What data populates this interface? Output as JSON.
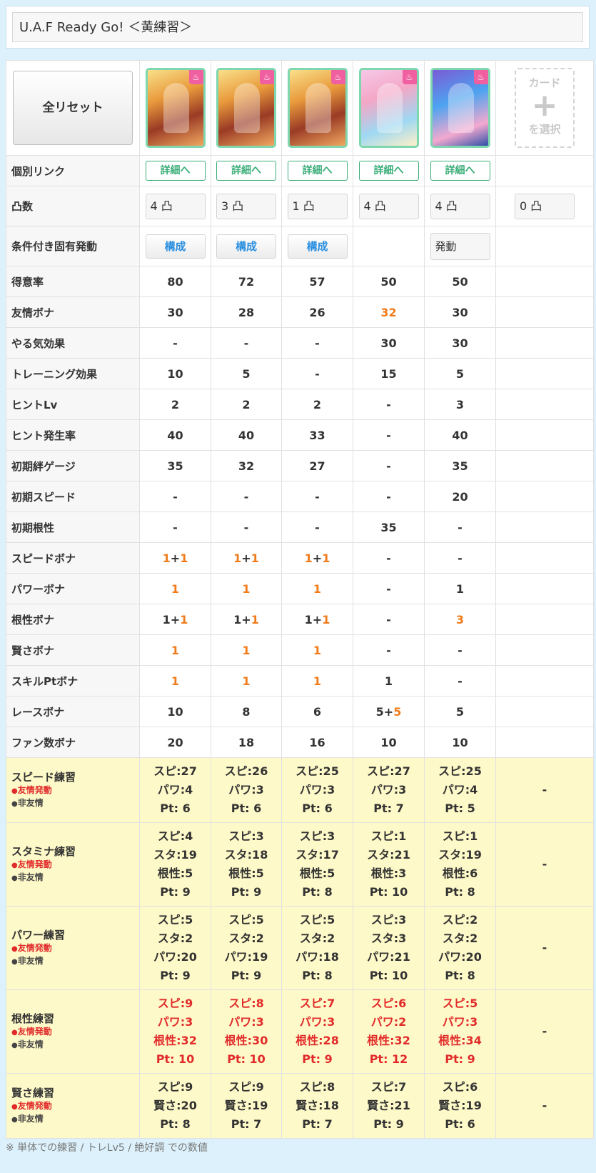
{
  "title": "U.A.F Ready Go! ＜黄練習＞",
  "reset_label": "全リセット",
  "empty_card": {
    "line1": "カード",
    "plus": "+",
    "line2": "を選択"
  },
  "card_flame_icon": "flame-icon",
  "cards": [
    {
      "style": "c1"
    },
    {
      "style": "c1"
    },
    {
      "style": "c1"
    },
    {
      "style": "c2"
    },
    {
      "style": "c3"
    }
  ],
  "link_row": {
    "label": "個別リンク",
    "button": "詳細へ"
  },
  "totsu_row": {
    "label": "凸数",
    "values": [
      "4 凸",
      "3 凸",
      "1 凸",
      "4 凸",
      "4 凸",
      "0 凸"
    ]
  },
  "cond_row": {
    "label": "条件付き固有発動",
    "button": "構成",
    "static": "発動"
  },
  "stats": [
    {
      "label": "得意率",
      "values": [
        "80",
        "72",
        "57",
        "50",
        "50",
        ""
      ]
    },
    {
      "label": "友情ボナ",
      "values": [
        "30",
        "28",
        "26",
        "32",
        "30",
        ""
      ],
      "orange": [
        3
      ]
    },
    {
      "label": "やる気効果",
      "values": [
        "-",
        "-",
        "-",
        "30",
        "30",
        ""
      ]
    },
    {
      "label": "トレーニング効果",
      "values": [
        "10",
        "5",
        "-",
        "15",
        "5",
        ""
      ]
    },
    {
      "label": "ヒントLv",
      "values": [
        "2",
        "2",
        "2",
        "-",
        "3",
        ""
      ]
    },
    {
      "label": "ヒント発生率",
      "values": [
        "40",
        "40",
        "33",
        "-",
        "40",
        ""
      ]
    },
    {
      "label": "初期絆ゲージ",
      "values": [
        "35",
        "32",
        "27",
        "-",
        "35",
        ""
      ]
    },
    {
      "label": "初期スピード",
      "values": [
        "-",
        "-",
        "-",
        "-",
        "20",
        ""
      ]
    },
    {
      "label": "初期根性",
      "values": [
        "-",
        "-",
        "-",
        "35",
        "-",
        ""
      ]
    },
    {
      "label": "スピードボナ",
      "values": [
        "1+1",
        "1+1",
        "1+1",
        "-",
        "-",
        ""
      ]
    },
    {
      "label": "パワーボナ",
      "values": [
        "1",
        "1",
        "1",
        "-",
        "1",
        ""
      ]
    },
    {
      "label": "根性ボナ",
      "values": [
        "1+1",
        "1+1",
        "1+1",
        "-",
        "3",
        ""
      ]
    },
    {
      "label": "賢さボナ",
      "values": [
        "1",
        "1",
        "1",
        "-",
        "-",
        ""
      ]
    },
    {
      "label": "スキルPtボナ",
      "values": [
        "1",
        "1",
        "1",
        "1",
        "-",
        ""
      ]
    },
    {
      "label": "レースボナ",
      "values": [
        "10",
        "8",
        "6",
        "5+5",
        "5",
        ""
      ]
    },
    {
      "label": "ファン数ボナ",
      "values": [
        "20",
        "18",
        "16",
        "10",
        "10",
        ""
      ]
    }
  ],
  "legend": {
    "on": "友情発動",
    "off": "非友情",
    "dot": "●"
  },
  "trainings": [
    {
      "name": "スピード練習",
      "cells": [
        [
          "スピ:27",
          "パワ:4",
          "Pt: 6"
        ],
        [
          "スピ:26",
          "パワ:3",
          "Pt: 6"
        ],
        [
          "スピ:25",
          "パワ:3",
          "Pt: 6"
        ],
        [
          "スピ:27",
          "パワ:3",
          "Pt: 7"
        ],
        [
          "スピ:25",
          "パワ:4",
          "Pt: 5"
        ]
      ],
      "last": "-"
    },
    {
      "name": "スタミナ練習",
      "cells": [
        [
          "スピ:4",
          "スタ:19",
          "根性:5",
          "Pt: 9"
        ],
        [
          "スピ:3",
          "スタ:18",
          "根性:5",
          "Pt: 9"
        ],
        [
          "スピ:3",
          "スタ:17",
          "根性:5",
          "Pt: 8"
        ],
        [
          "スピ:1",
          "スタ:21",
          "根性:3",
          "Pt: 10"
        ],
        [
          "スピ:1",
          "スタ:19",
          "根性:6",
          "Pt: 8"
        ]
      ],
      "last": "-"
    },
    {
      "name": "パワー練習",
      "cells": [
        [
          "スピ:5",
          "スタ:2",
          "パワ:20",
          "Pt: 9"
        ],
        [
          "スピ:5",
          "スタ:2",
          "パワ:19",
          "Pt: 9"
        ],
        [
          "スピ:5",
          "スタ:2",
          "パワ:18",
          "Pt: 8"
        ],
        [
          "スピ:3",
          "スタ:3",
          "パワ:21",
          "Pt: 10"
        ],
        [
          "スピ:2",
          "スタ:2",
          "パワ:20",
          "Pt: 8"
        ]
      ],
      "last": "-"
    },
    {
      "name": "根性練習",
      "red": true,
      "cells": [
        [
          "スピ:9",
          "パワ:3",
          "根性:32",
          "Pt: 10"
        ],
        [
          "スピ:8",
          "パワ:3",
          "根性:30",
          "Pt: 10"
        ],
        [
          "スピ:7",
          "パワ:3",
          "根性:28",
          "Pt: 9"
        ],
        [
          "スピ:6",
          "パワ:2",
          "根性:32",
          "Pt: 12"
        ],
        [
          "スピ:5",
          "パワ:3",
          "根性:34",
          "Pt: 9"
        ]
      ],
      "last": "-"
    },
    {
      "name": "賢さ練習",
      "cells": [
        [
          "スピ:9",
          "賢さ:20",
          "Pt: 8"
        ],
        [
          "スピ:9",
          "賢さ:19",
          "Pt: 7"
        ],
        [
          "スピ:8",
          "賢さ:18",
          "Pt: 7"
        ],
        [
          "スピ:7",
          "賢さ:21",
          "Pt: 9"
        ],
        [
          "スピ:6",
          "賢さ:19",
          "Pt: 6"
        ]
      ],
      "last": "-"
    }
  ],
  "footnote": "※ 単体での練習 / トレLv5 / 絶好調 での数値",
  "colors": {
    "accent_orange": "#f07b1a",
    "friendship_red": "#e12b2b",
    "link_green": "#3aad78",
    "build_blue": "#2a8fe0",
    "training_bg": "#fef9c8",
    "page_bg": "#dcf1fb"
  }
}
